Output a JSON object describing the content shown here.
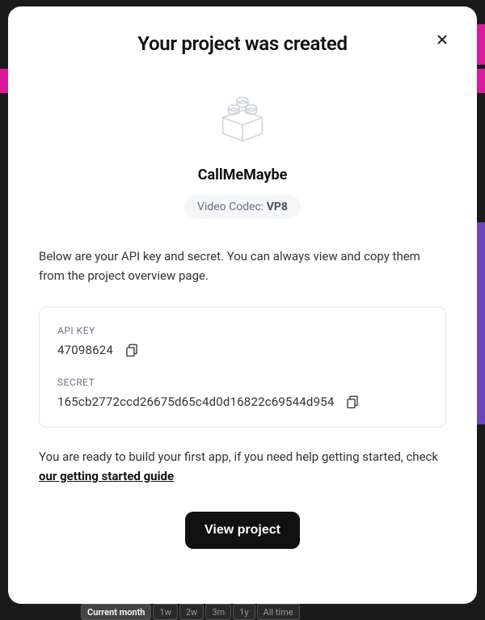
{
  "modal": {
    "title": "Your project was created",
    "project_name": "CallMeMaybe",
    "codec": {
      "label": "Video Codec: ",
      "value": "VP8"
    },
    "intro_text": "Below are your API key and secret. You can always view and copy them from the project overview page.",
    "credentials": {
      "api_key": {
        "label": "API KEY",
        "value": "47098624"
      },
      "secret": {
        "label": "SECRET",
        "value": "165cb2772ccd26675d65c4d0d16822c69544d954"
      }
    },
    "outro": {
      "before": "You are ready to build your first app, if you need help getting started, check ",
      "link": "our getting started guide"
    },
    "view_button": "View project"
  },
  "background": {
    "timerange": {
      "current": "Current month",
      "options": [
        "1w",
        "2w",
        "3m",
        "1y",
        "All time"
      ]
    }
  }
}
